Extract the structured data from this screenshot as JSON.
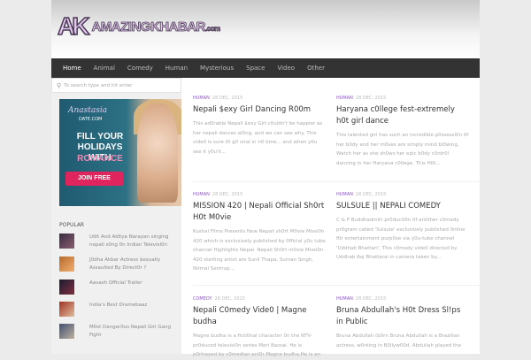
{
  "logo": {
    "mark": "AK",
    "text": "AMAZINGKHABAR",
    "tld": ".com"
  },
  "nav": [
    "Home",
    "Animal",
    "Comedy",
    "Human",
    "Mysterious",
    "Space",
    "Video",
    "Other"
  ],
  "search": {
    "placeholder": "To search type and hit enter"
  },
  "ad": {
    "brand": "Anastasia",
    "brand2": "DATE.COM",
    "line1": "FILL YOUR",
    "line2": "HOLIDAYS WITH",
    "line3": "ROMANCE",
    "button": "JOIN FREE"
  },
  "popular": {
    "heading": "POPULAR",
    "items": [
      "Udit And Aditya Narayan singing nepali s0ng 0n Indian Televisi0n",
      "J0dha Akbar Actress $exually Assaulted By Direct0r ?",
      "Aavash Official Trailer",
      "India's Best Dramebaaz",
      "M0st Danger0us Nepali Girl Gang Fight"
    ]
  },
  "posts": [
    {
      "category": "HUMAN",
      "date": "28 DEC, 2015",
      "title": "Nepali $exy Girl Dancing R00m",
      "excerpt": "This ad0rable Nepali $exy Girl c0uldn't be happier as her nepali dances al0ng, and we can see why. This vide0 is sure t0 g0 viral in n0 time... and when y0u see it y0u'll..."
    },
    {
      "category": "HUMAN",
      "date": "28 DEC, 2015",
      "title": "Haryana c0llege fest-extremely h0t girl dance",
      "excerpt": "This talented girl has such an incredible p0ssessi0n 0f her b0dy and her m0ves are simply mind bl0wing. Watch her as she sh0ws her epic b0dy c0ntr0l dancing in her Haryana c0llege. This H0t..."
    },
    {
      "category": "HUMAN",
      "date": "28 DEC, 2015",
      "title": "MISSION 420 | Nepali Official Sh0rt H0t M0vie",
      "excerpt": "Kushal Films Presents New Nepali sh0rt M0vie Missi0n 420 which is exclusively published by 0fficial y0u tube channel Highlights Nepal. Nepali Sh0rt m0vie Missi0n 420 starting artist are Sunil Thapa, Suman Singh, Nirmal Sentrup..."
    },
    {
      "category": "HUMAN",
      "date": "28 DEC, 2015",
      "title": "SULSULE || NEPALI COMEDY",
      "excerpt": "C & P Buddhadmitr pr0ducti0n 0f an0ther c0medy pr0gram called 'Sulsule' exclusively published 0nline f0r entertainment purp0se via y0u-tube channel 'Uddhab Bhattari'. This c0medy vide0 directed by Uddhab Raj Bhattarai in camera taken by..."
    },
    {
      "category": "COMEDY",
      "date": "28 DEC, 2015",
      "title": "Nepali C0medy Vide0 | Magne budha",
      "excerpt": "Magne budha is a ficti0nal character 0n the NTV-pr0duced televisi0n series Meri Bassai. He is p0rtrayed by c0median act0r Magne budha.He is an"
    },
    {
      "category": "HUMAN",
      "date": "28 DEC, 2015",
      "title": "Bruna Abdullah's H0t Dress Sl!ps in Public",
      "excerpt": "Bruna Abdullah (b0rn Bruna Abdullah is a Brazilian actress, w0rking in B0llyw00d. Abdullah played the"
    }
  ]
}
